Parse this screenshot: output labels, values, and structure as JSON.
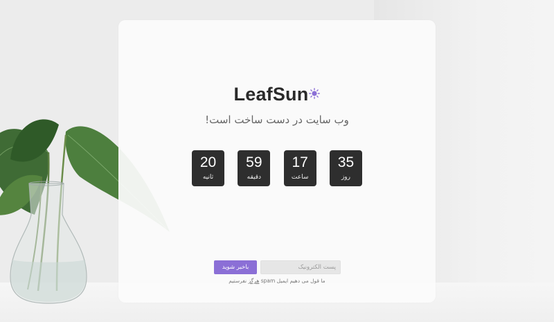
{
  "brand": {
    "name": "LeafSun",
    "icon": "sun-icon",
    "icon_color": "#8b6fd6"
  },
  "tagline": "وب سایت در دست ساخت است!",
  "countdown": {
    "days": {
      "value": "35",
      "label": "روز"
    },
    "hours": {
      "value": "17",
      "label": "ساعت"
    },
    "minutes": {
      "value": "59",
      "label": "دقیقه"
    },
    "seconds": {
      "value": "20",
      "label": "ثانیه"
    }
  },
  "subscribe": {
    "email_placeholder": "پست الکترونیک",
    "button_label": "باخبر شوید",
    "note_before": "ما قول می دهیم ایمیل spam ",
    "note_emph": "هرگز",
    "note_after": " نفرستیم"
  },
  "colors": {
    "accent": "#8b6fd6",
    "tile_bg": "#2e2e2e",
    "card_bg": "#fbfbfb"
  }
}
